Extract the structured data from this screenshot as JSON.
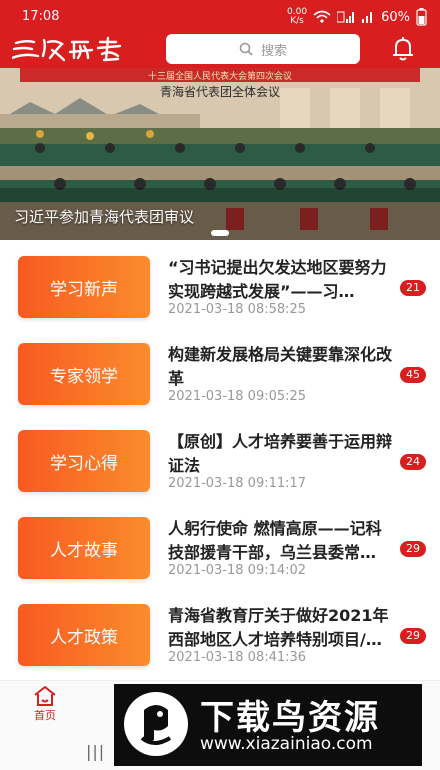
{
  "status": {
    "time": "17:08",
    "speed_value": "0.00",
    "speed_unit": "K/s",
    "battery": "60%"
  },
  "header": {
    "search_placeholder": "搜索",
    "logo_icon": "calligraphy-logo",
    "bell_icon": "bell-icon",
    "accent": "#d81e1e"
  },
  "banner": {
    "caption": "习近平参加青海代表团审议",
    "sign_text": "青海省代表团全体会议",
    "sign_subtext": "十三届全国人民代表大会第四次会议"
  },
  "items": [
    {
      "tag": "学习新声",
      "title": "“习书记提出欠发达地区要努力实现跨越式发展”——习…",
      "time": "2021-03-18 08:58:25",
      "count": "21"
    },
    {
      "tag": "专家领学",
      "title": "构建新发展格局关键要靠深化改革",
      "time": "2021-03-18 09:05:25",
      "count": "45"
    },
    {
      "tag": "学习心得",
      "title": "【原创】人才培养要善于运用辩证法",
      "time": "2021-03-18 09:11:17",
      "count": "24"
    },
    {
      "tag": "人才故事",
      "title": "人躬行使命 燃情高原——记科技部援青干部，乌兰县委常…",
      "time": "2021-03-18 09:14:02",
      "count": "29"
    },
    {
      "tag": "人才政策",
      "title": "青海省教育厅关于做好2021年西部地区人才培养特别项目/…",
      "time": "2021-03-18 08:41:36",
      "count": "29"
    }
  ],
  "nav": {
    "home_label": "首页"
  },
  "watermark": {
    "title": "下载鸟资源",
    "url": "www.xiazainiao.com"
  }
}
